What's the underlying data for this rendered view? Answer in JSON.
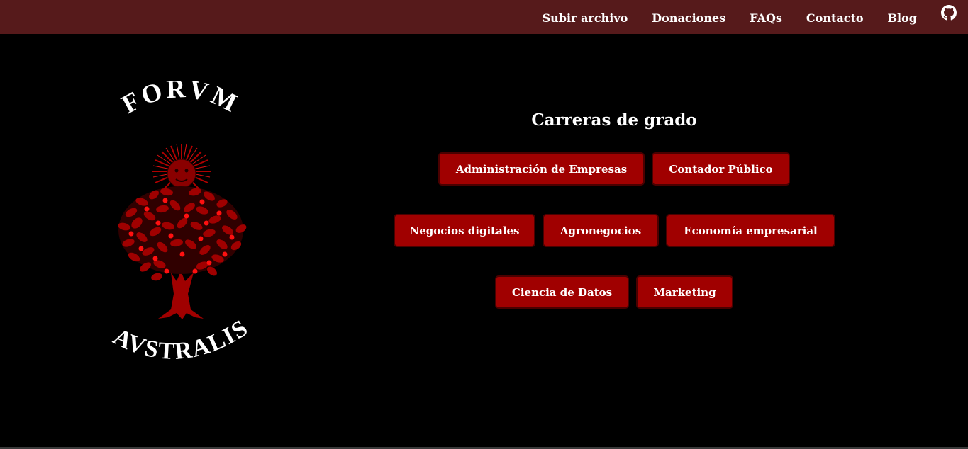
{
  "nav": {
    "items": [
      {
        "label": "Subir archivo"
      },
      {
        "label": "Donaciones"
      },
      {
        "label": "FAQs"
      },
      {
        "label": "Contacto"
      },
      {
        "label": "Blog"
      }
    ],
    "github_icon": "github-icon"
  },
  "logo": {
    "top_text": "FORVM",
    "bottom_text": "AVSTRALIS"
  },
  "main": {
    "title": "Carreras de grado",
    "careers": [
      {
        "label": "Administración de Empresas"
      },
      {
        "label": "Contador Público"
      },
      {
        "label": "Negocios digitales"
      },
      {
        "label": "Agronegocios"
      },
      {
        "label": "Economía empresarial"
      },
      {
        "label": "Ciencia de Datos"
      },
      {
        "label": "Marketing"
      }
    ]
  },
  "colors": {
    "topbar": "#561a1b",
    "background": "#000000",
    "button": "#a00000",
    "button_border": "#4a0000"
  }
}
